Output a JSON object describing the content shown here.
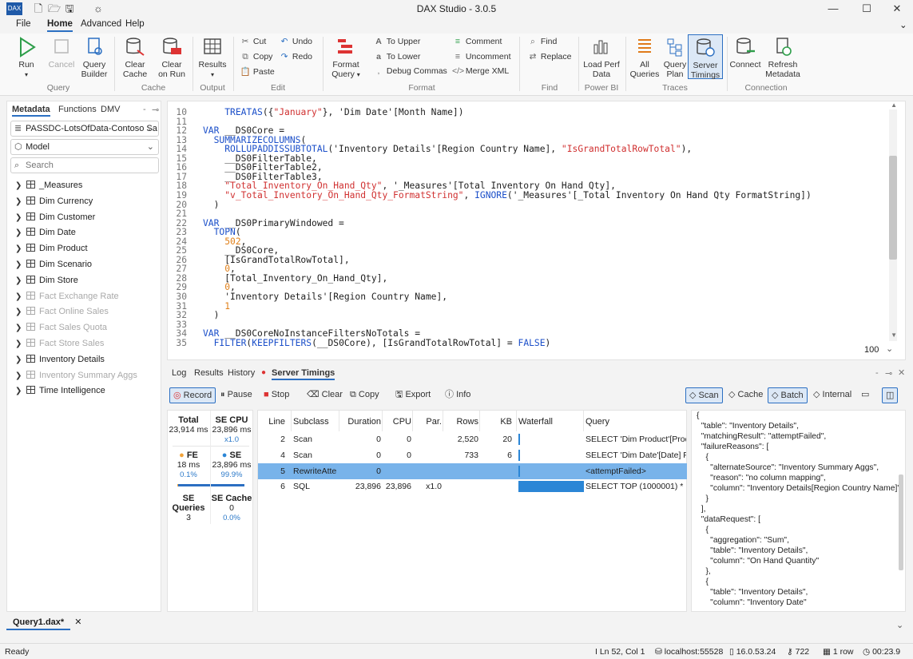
{
  "window": {
    "title": "DAX Studio - 3.0.5"
  },
  "menu": [
    "File",
    "Home",
    "Advanced",
    "Help"
  ],
  "ribbon": {
    "run": "Run",
    "cancel": "Cancel",
    "query_builder_1": "Query",
    "query_builder_2": "Builder",
    "clear_cache_1": "Clear",
    "clear_cache_2": "Cache",
    "clear_on_run_1": "Clear",
    "clear_on_run_2": "on Run",
    "results": "Results",
    "cut": "Cut",
    "copy": "Copy",
    "paste": "Paste",
    "undo": "Undo",
    "redo": "Redo",
    "format_query_1": "Format",
    "format_query_2": "Query",
    "to_upper": "To Upper",
    "to_lower": "To Lower",
    "debug_commas": "Debug Commas",
    "comment": "Comment",
    "uncomment": "Uncomment",
    "merge_xml": "Merge XML",
    "find": "Find",
    "replace": "Replace",
    "load_perf_1": "Load Perf",
    "load_perf_2": "Data",
    "all_queries_1": "All",
    "all_queries_2": "Queries",
    "query_plan_1": "Query",
    "query_plan_2": "Plan",
    "server_timings_1": "Server",
    "server_timings_2": "Timings",
    "connect": "Connect",
    "refresh_metadata_1": "Refresh",
    "refresh_metadata_2": "Metadata",
    "groups": [
      "Query",
      "Cache",
      "Output",
      "Edit",
      "Format",
      "Find",
      "Power BI",
      "Traces",
      "Connection"
    ]
  },
  "left_panel": {
    "tabs": [
      "Metadata",
      "Functions",
      "DMV"
    ],
    "database": "PASSDC-LotsOfData-Contoso Sa",
    "model": "Model",
    "search_placeholder": "Search",
    "tables": [
      {
        "name": "_Measures",
        "hidden": false
      },
      {
        "name": "Dim Currency",
        "hidden": false
      },
      {
        "name": "Dim Customer",
        "hidden": false
      },
      {
        "name": "Dim Date",
        "hidden": false
      },
      {
        "name": "Dim Product",
        "hidden": false
      },
      {
        "name": "Dim Scenario",
        "hidden": false
      },
      {
        "name": "Dim Store",
        "hidden": false
      },
      {
        "name": "Fact Exchange Rate",
        "hidden": true
      },
      {
        "name": "Fact Online Sales",
        "hidden": true
      },
      {
        "name": "Fact Sales Quota",
        "hidden": true
      },
      {
        "name": "Fact Store Sales",
        "hidden": true
      },
      {
        "name": "Inventory Details",
        "hidden": false
      },
      {
        "name": "Inventory Summary Aggs",
        "hidden": true
      },
      {
        "name": "Time Intelligence",
        "hidden": false
      }
    ]
  },
  "editor": {
    "zoom": "100",
    "lines": [
      {
        "n": "10",
        "code": "    TREATAS({\"January\"}, 'Dim Date'[Month Name])"
      },
      {
        "n": "11",
        "code": ""
      },
      {
        "n": "12",
        "code": "VAR __DS0Core ="
      },
      {
        "n": "13",
        "code": "  SUMMARIZECOLUMNS("
      },
      {
        "n": "14",
        "code": "    ROLLUPADDISSUBTOTAL('Inventory Details'[Region Country Name], \"IsGrandTotalRowTotal\"),"
      },
      {
        "n": "15",
        "code": "    __DS0FilterTable,"
      },
      {
        "n": "16",
        "code": "    __DS0FilterTable2,"
      },
      {
        "n": "17",
        "code": "    __DS0FilterTable3,"
      },
      {
        "n": "18",
        "code": "    \"Total_Inventory_On_Hand_Qty\", '_Measures'[Total Inventory On Hand Qty],"
      },
      {
        "n": "19",
        "code": "    \"v_Total_Inventory_On_Hand_Qty_FormatString\", IGNORE('_Measures'[_Total Inventory On Hand Qty FormatString])"
      },
      {
        "n": "20",
        "code": "  )"
      },
      {
        "n": "21",
        "code": ""
      },
      {
        "n": "22",
        "code": "VAR __DS0PrimaryWindowed ="
      },
      {
        "n": "23",
        "code": "  TOPN("
      },
      {
        "n": "24",
        "code": "    502,"
      },
      {
        "n": "25",
        "code": "    __DS0Core,"
      },
      {
        "n": "26",
        "code": "    [IsGrandTotalRowTotal],"
      },
      {
        "n": "27",
        "code": "    0,"
      },
      {
        "n": "28",
        "code": "    [Total_Inventory_On_Hand_Qty],"
      },
      {
        "n": "29",
        "code": "    0,"
      },
      {
        "n": "30",
        "code": "    'Inventory Details'[Region Country Name],"
      },
      {
        "n": "31",
        "code": "    1"
      },
      {
        "n": "32",
        "code": "  )"
      },
      {
        "n": "33",
        "code": ""
      },
      {
        "n": "34",
        "code": "VAR __DS0CoreNoInstanceFiltersNoTotals ="
      },
      {
        "n": "35",
        "code": "  FILTER(KEEPFILTERS(__DS0Core), [IsGrandTotalRowTotal] = FALSE)"
      }
    ]
  },
  "bottom_tabs": [
    "Log",
    "Results",
    "History",
    "Server Timings"
  ],
  "toolbar": {
    "record": "Record",
    "pause": "Pause",
    "stop": "Stop",
    "clear": "Clear",
    "copy": "Copy",
    "export": "Export",
    "info": "Info",
    "scan": "Scan",
    "cache": "Cache",
    "batch": "Batch",
    "internal": "Internal"
  },
  "stats": {
    "total_label": "Total",
    "total_value": "23,914 ms",
    "secpu_label": "SE CPU",
    "secpu_value": "23,896 ms",
    "secpu_ratio": "x1.0",
    "fe_label": "FE",
    "fe_value": "18 ms",
    "fe_pct": "0.1%",
    "se_label": "SE",
    "se_value": "23,896 ms",
    "se_pct": "99.9%",
    "sequeries_label": "SE Queries",
    "sequeries_value": "3",
    "secache_label": "SE Cache",
    "secache_value": "0",
    "secache_pct": "0.0%"
  },
  "grid": {
    "headers": [
      "Line",
      "Subclass",
      "Duration",
      "CPU",
      "Par.",
      "Rows",
      "KB",
      "Waterfall",
      "Query"
    ],
    "rows": [
      {
        "line": "2",
        "subclass": "Scan",
        "duration": "0",
        "cpu": "0",
        "par": "",
        "rows": "2,520",
        "kb": "20",
        "query": "SELECT 'Dim Product'[Prod",
        "wf": 0.02
      },
      {
        "line": "4",
        "subclass": "Scan",
        "duration": "0",
        "cpu": "0",
        "par": "",
        "rows": "733",
        "kb": "6",
        "query": "SELECT 'Dim Date'[Date] F",
        "wf": 0.02
      },
      {
        "line": "5",
        "subclass": "RewriteAttempted",
        "duration": "0",
        "cpu": "",
        "par": "",
        "rows": "",
        "kb": "",
        "query": "<attemptFailed>",
        "wf": 0.02
      },
      {
        "line": "6",
        "subclass": "SQL",
        "duration": "23,896",
        "cpu": "23,896",
        "par": "x1.0",
        "rows": "",
        "kb": "",
        "query": "SELECT  TOP (1000001) * F",
        "wf": 1.0
      }
    ]
  },
  "json_panel": [
    "{",
    "  \"table\": \"Inventory Details\",",
    "  \"matchingResult\": \"attemptFailed\",",
    "  \"failureReasons\": [",
    "    {",
    "      \"alternateSource\": \"Inventory Summary Aggs\",",
    "      \"reason\": \"no column mapping\",",
    "      \"column\": \"Inventory Details[Region Country Name]\"",
    "    }",
    "  ],",
    "  \"dataRequest\": [",
    "    {",
    "      \"aggregation\": \"Sum\",",
    "      \"table\": \"Inventory Details\",",
    "      \"column\": \"On Hand Quantity\"",
    "    },",
    "    {",
    "      \"table\": \"Inventory Details\",",
    "      \"column\": \"Inventory Date\""
  ],
  "doc_tab": "Query1.dax*",
  "status": {
    "ready": "Ready",
    "position": "Ln 52, Col 1",
    "server": "localhost:55528",
    "version": "16.0.53.24",
    "spid": "722",
    "rows": "1 row",
    "time": "00:23.9"
  }
}
